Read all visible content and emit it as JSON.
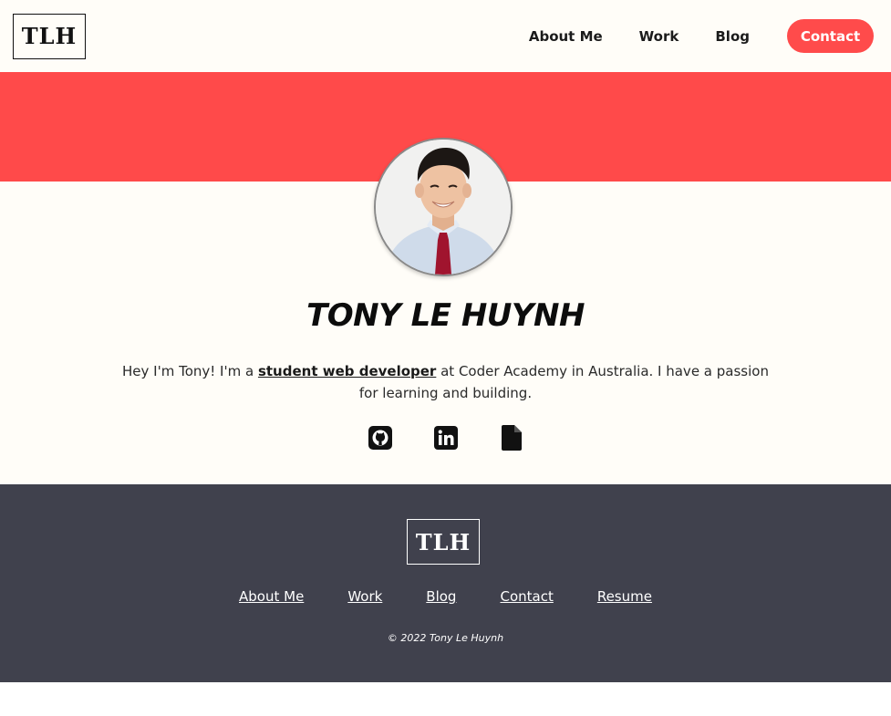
{
  "header": {
    "logo_text": "TLH",
    "nav": [
      {
        "label": "About Me"
      },
      {
        "label": "Work"
      },
      {
        "label": "Blog"
      }
    ],
    "contact_label": "Contact"
  },
  "hero": {
    "name": "TONY LE HUYNH",
    "intro_prefix": "Hey I'm Tony! I'm a ",
    "intro_highlight": "student web developer",
    "intro_suffix": " at Coder Academy in Australia. I have a passion for learning and building.",
    "socials": [
      {
        "icon": "github-icon"
      },
      {
        "icon": "linkedin-icon"
      },
      {
        "icon": "file-icon"
      }
    ]
  },
  "footer": {
    "logo_text": "TLH",
    "links": [
      {
        "label": "About Me"
      },
      {
        "label": "Work"
      },
      {
        "label": "Blog"
      },
      {
        "label": "Contact"
      },
      {
        "label": "Resume"
      }
    ],
    "copyright": "© 2022 Tony Le Huynh"
  },
  "colors": {
    "accent": "#ff4a4a",
    "footer_bg": "#40414d",
    "page_bg": "#fffdf8"
  }
}
